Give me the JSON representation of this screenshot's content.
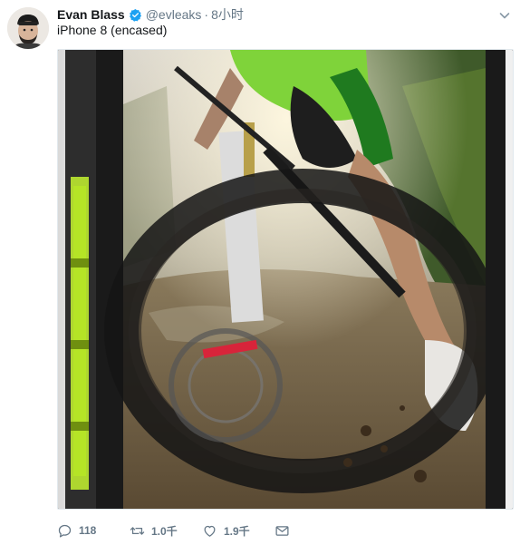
{
  "tweet": {
    "author_name": "Evan Blass",
    "handle": "@evleaks",
    "separator": "·",
    "time": "8小时",
    "text": "iPhone 8 (encased)",
    "avatar_icon": "person-avatar-icon",
    "verified_icon": "verified-badge-icon",
    "menu_icon": "chevron-down-icon",
    "media_description_icon": "photo-icon"
  },
  "actions": {
    "reply_count": "118",
    "retweet_count": "1.0千",
    "like_count": "1.9千",
    "reply_icon": "reply-icon",
    "retweet_icon": "retweet-icon",
    "like_icon": "heart-icon",
    "dm_icon": "envelope-icon"
  },
  "colors": {
    "verified_blue": "#1da1f2",
    "secondary_text": "#657786",
    "primary_text": "#14171a",
    "case_accent": "#c6f530"
  }
}
